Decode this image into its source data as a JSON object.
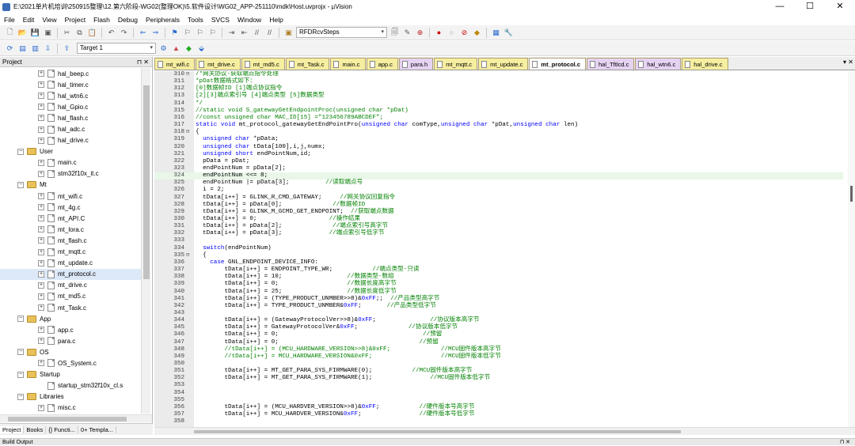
{
  "window": {
    "title": "E:\\2021单片机培训\\250915整理\\12.第六阶段-WG02(整理OK)\\5.软件设计\\WG02_APP-251110\\mdk\\Host.uvprojx - µVision",
    "minimize": "—",
    "maximize": "☐",
    "close": "✕"
  },
  "menu": [
    "File",
    "Edit",
    "View",
    "Project",
    "Flash",
    "Debug",
    "Peripherals",
    "Tools",
    "SVCS",
    "Window",
    "Help"
  ],
  "toolbar": {
    "find_combo": "RFDRcvSteps",
    "target_combo": "Target 1"
  },
  "project": {
    "header": "Project",
    "pin": "⊓ ✕",
    "tree": [
      {
        "kind": "file",
        "label": "hal_beep.c",
        "depth": 2
      },
      {
        "kind": "file",
        "label": "hal_timer.c",
        "depth": 2
      },
      {
        "kind": "file",
        "label": "hal_wtn6.c",
        "depth": 2
      },
      {
        "kind": "file",
        "label": "hal_Gpio.c",
        "depth": 2
      },
      {
        "kind": "file",
        "label": "hal_flash.c",
        "depth": 2
      },
      {
        "kind": "file",
        "label": "hal_adc.c",
        "depth": 2
      },
      {
        "kind": "file",
        "label": "hal_drive.c",
        "depth": 2
      },
      {
        "kind": "folder",
        "label": "User",
        "depth": 1
      },
      {
        "kind": "file",
        "label": "main.c",
        "depth": 2
      },
      {
        "kind": "file",
        "label": "stm32f10x_it.c",
        "depth": 2
      },
      {
        "kind": "folder",
        "label": "Mt",
        "depth": 1
      },
      {
        "kind": "file",
        "label": "mt_wifi.c",
        "depth": 2
      },
      {
        "kind": "file",
        "label": "mt_4g.c",
        "depth": 2
      },
      {
        "kind": "file",
        "label": "mt_API.C",
        "depth": 2
      },
      {
        "kind": "file",
        "label": "mt_lora.c",
        "depth": 2
      },
      {
        "kind": "file",
        "label": "mt_flash.c",
        "depth": 2
      },
      {
        "kind": "file",
        "label": "mt_mqtt.c",
        "depth": 2
      },
      {
        "kind": "file",
        "label": "mt_update.c",
        "depth": 2
      },
      {
        "kind": "file",
        "label": "mt_protocol.c",
        "depth": 2,
        "selected": true
      },
      {
        "kind": "file",
        "label": "mt_drive.c",
        "depth": 2
      },
      {
        "kind": "file",
        "label": "mt_md5.c",
        "depth": 2
      },
      {
        "kind": "file",
        "label": "mt_Task.c",
        "depth": 2
      },
      {
        "kind": "folder",
        "label": "App",
        "depth": 1
      },
      {
        "kind": "file",
        "label": "app.c",
        "depth": 2
      },
      {
        "kind": "file",
        "label": "para.c",
        "depth": 2
      },
      {
        "kind": "folder",
        "label": "OS",
        "depth": 1
      },
      {
        "kind": "file",
        "label": "OS_System.c",
        "depth": 2
      },
      {
        "kind": "folder",
        "label": "Startup",
        "depth": 1
      },
      {
        "kind": "leaf",
        "label": "startup_stm32f10x_cl.s",
        "depth": 2
      },
      {
        "kind": "folder",
        "label": "Libraries",
        "depth": 1
      },
      {
        "kind": "file",
        "label": "misc.c",
        "depth": 2
      }
    ],
    "bottom_tabs": [
      "Project",
      "Books",
      "{} Functi...",
      "0+ Templa..."
    ]
  },
  "tabs": [
    {
      "label": "mt_wifi.c",
      "type": "c"
    },
    {
      "label": "mt_drive.c",
      "type": "c"
    },
    {
      "label": "mt_md5.c",
      "type": "c"
    },
    {
      "label": "mt_Task.c",
      "type": "c"
    },
    {
      "label": "main.c",
      "type": "c"
    },
    {
      "label": "app.c",
      "type": "c"
    },
    {
      "label": "para.h",
      "type": "h"
    },
    {
      "label": "mt_mqtt.c",
      "type": "c"
    },
    {
      "label": "mt_update.c",
      "type": "c"
    },
    {
      "label": "mt_protocol.c",
      "type": "c",
      "active": true
    },
    {
      "label": "hal_Tftlcd.c",
      "type": "h"
    },
    {
      "label": "hal_wtn6.c",
      "type": "h"
    },
    {
      "label": "hal_drive.c",
      "type": "c"
    }
  ],
  "tab_menu": "▾ ✕",
  "code": [
    {
      "n": "310",
      "fold": "⊟",
      "t": "/*网关协议-获取端点指令处理",
      "c": true
    },
    {
      "n": "311",
      "t": "*pDat数据格式如下：",
      "c": true
    },
    {
      "n": "312",
      "t": "[0]数据帧ID [1]端点协议指令",
      "c": true
    },
    {
      "n": "313",
      "t": "[2][3]端点索引号 [4]端点类型 [5]数据类型",
      "c": true
    },
    {
      "n": "314",
      "t": "*/",
      "c": true
    },
    {
      "n": "315",
      "t": "//static void S_gatewayGetEndpointProc(unsigned char *pDat)",
      "c": true
    },
    {
      "n": "316",
      "t": "//const unsigned char MAC_ID[15] =\"123456789ABCDEF\";",
      "c": true
    },
    {
      "n": "317",
      "t": "static void mt_protocol_gatewayGetEndPointPro(unsigned char comType,unsigned char *pDat,unsigned char len)"
    },
    {
      "n": "318",
      "fold": "⊟",
      "t": "{"
    },
    {
      "n": "319",
      "t": "  unsigned char *pData;"
    },
    {
      "n": "320",
      "t": "  unsigned char tData[100],i,j,numx;"
    },
    {
      "n": "321",
      "t": "  unsigned short endPointNum,id;"
    },
    {
      "n": "322",
      "t": "  pData = pDat;"
    },
    {
      "n": "323",
      "t": "  endPointNum = pData[2];"
    },
    {
      "n": "324",
      "t": "  endPointNum <<= 8;",
      "hl": true
    },
    {
      "n": "325",
      "t": "  endPointNum |= pData[3];          //读取端点号"
    },
    {
      "n": "326",
      "t": "  i = 2;"
    },
    {
      "n": "327",
      "t": "  tData[i++] = GLINK_R_CMD_GATEWAY;     //网关协议回复指令"
    },
    {
      "n": "328",
      "t": "  tData[i++] = pData[0];              //数据帧ID"
    },
    {
      "n": "329",
      "t": "  tData[i++] = GLINK_M_GCMD_GET_ENDPOINT;  //获取端点数据"
    },
    {
      "n": "330",
      "t": "  tData[i++] = 0;                    //操作结果"
    },
    {
      "n": "331",
      "t": "  tData[i++] = pData[2];              //端点索引号高字节"
    },
    {
      "n": "332",
      "t": "  tData[i++] = pData[3];             //端点索引号低字节"
    },
    {
      "n": "333",
      "t": ""
    },
    {
      "n": "334",
      "t": "  switch(endPointNum)"
    },
    {
      "n": "335",
      "fold": "⊟",
      "t": "  {"
    },
    {
      "n": "336",
      "t": "    case GNL_ENDPOINT_DEVICE_INFO:"
    },
    {
      "n": "337",
      "t": "        tData[i++] = ENDPOINT_TYPE_WR;           //端点类型-只读"
    },
    {
      "n": "338",
      "t": "        tData[i++] = 10;                  //数据类型-数组"
    },
    {
      "n": "339",
      "t": "        tData[i++] = 0;                   //数据长度高字节"
    },
    {
      "n": "340",
      "t": "        tData[i++] = 25;                  //数据长度低字节"
    },
    {
      "n": "341",
      "t": "        tData[i++] = (TYPE_PRODUCT_UNMBER>>8)&0xFF;;  //产品类型高字节"
    },
    {
      "n": "342",
      "t": "        tData[i++] = TYPE_PRODUCT_UNMBER&0xFF;       //产品类型低字节"
    },
    {
      "n": "343",
      "t": ""
    },
    {
      "n": "344",
      "t": "        tData[i++] = (GatewayProtocolVer>>8)&0xFF;               //协议版本高字节"
    },
    {
      "n": "345",
      "t": "        tData[i++] = GatewayProtocolVer&0xFF;              //协议版本低字节"
    },
    {
      "n": "346",
      "t": "        tData[i++] = 0;                                        //预留"
    },
    {
      "n": "347",
      "t": "        tData[i++] = 0;                                       //预留"
    },
    {
      "n": "348",
      "t": "        //tData[i++] = (MCU_HARDWARE_VERSION>>8)&0xFF;              //MCU固件版本高字节",
      "c": true
    },
    {
      "n": "349",
      "t": "        //tData[i++] = MCU_HARDWARE_VERSION&0xFF;                   //MCU固件版本低字节",
      "c": true
    },
    {
      "n": "350",
      "t": ""
    },
    {
      "n": "351",
      "t": "        tData[i++] = MT_GET_PARA_SYS_FIRMWARE(0);           //MCU固件版本高字节"
    },
    {
      "n": "352",
      "t": "        tData[i++] = MT_GET_PARA_SYS_FIRMWARE(1);                //MCU固件版本低字节"
    },
    {
      "n": "353",
      "t": ""
    },
    {
      "n": "354",
      "t": ""
    },
    {
      "n": "355",
      "t": ""
    },
    {
      "n": "356",
      "t": "        tData[i++] = (MCU_HARDVER_VERSION>>8)&0xFF;           //硬件版本号高字节"
    },
    {
      "n": "357",
      "t": "        tData[i++] = MCU_HARDVER_VERSION&0xFF;                //硬件版本号低字节"
    },
    {
      "n": "358",
      "t": ""
    }
  ],
  "build_output": "Build Output",
  "build_pin": "⊓ ✕"
}
